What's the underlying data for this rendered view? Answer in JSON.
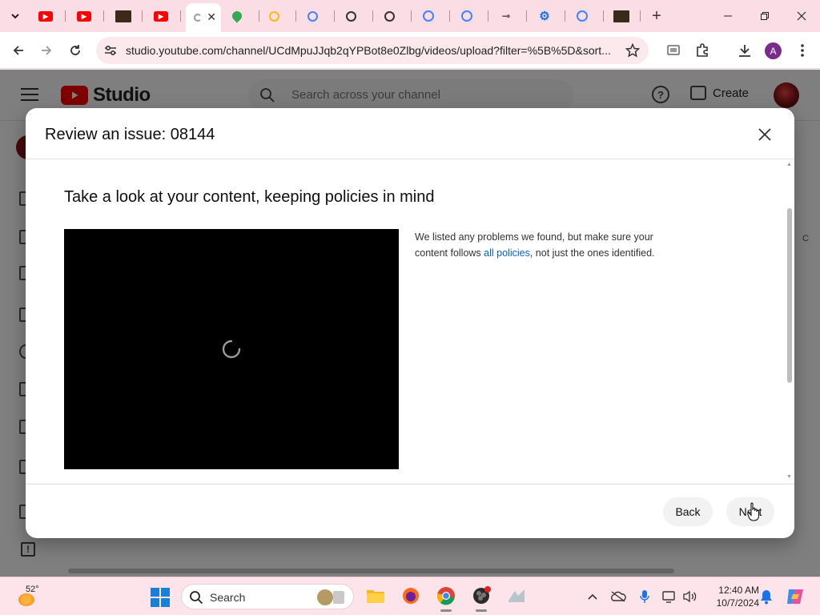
{
  "browser": {
    "tabs": [
      {
        "icon": "youtube-icon",
        "color": "#ff0000"
      },
      {
        "icon": "youtube-icon",
        "color": "#ff0000"
      },
      {
        "icon": "thumbnail-icon",
        "color": "#3a2a1a"
      },
      {
        "icon": "youtube-icon",
        "color": "#ff0000"
      },
      {
        "icon": "loading-icon",
        "color": "#999999",
        "active": true
      },
      {
        "icon": "maps-icon",
        "color": "#34a853"
      },
      {
        "icon": "photos-icon",
        "color": "#fbbc04"
      },
      {
        "icon": "photos-icon",
        "color": "#4285f4"
      },
      {
        "icon": "openai-icon",
        "color": "#333333"
      },
      {
        "icon": "chrome-icon",
        "color": "#333333"
      },
      {
        "icon": "google-icon",
        "color": "#4285f4"
      },
      {
        "icon": "google-icon",
        "color": "#4285f4"
      },
      {
        "icon": "key-icon",
        "color": "#555555"
      },
      {
        "icon": "gear-icon",
        "color": "#1a73e8"
      },
      {
        "icon": "google-icon",
        "color": "#4285f4"
      },
      {
        "icon": "thumbnail-icon",
        "color": "#3a2a1a"
      }
    ],
    "address_url": "studio.youtube.com/channel/UCdMpuJJqb2qYPBot8e0Zlbg/videos/upload?filter=%5B%5D&sort...",
    "profile_initial": "A"
  },
  "studio": {
    "logo_text": "Studio",
    "search_placeholder": "Search across your channel",
    "create_label": "Create",
    "column_fragment": "C"
  },
  "dialog": {
    "title": "Review an issue: 08144",
    "heading": "Take a look at your content, keeping policies in mind",
    "note_before": "We listed any problems we found, but make sure your content follows ",
    "note_link": "all policies",
    "note_after": ", not just the ones identified.",
    "back_label": "Back",
    "next_label": "Next"
  },
  "taskbar": {
    "temperature": "52°",
    "search_label": "Search",
    "time": "12:40 AM",
    "date": "10/7/2024"
  },
  "colors": {
    "accent_link": "#065fd4",
    "youtube_red": "#ff0000",
    "tabstrip_bg": "#fbdde5"
  }
}
